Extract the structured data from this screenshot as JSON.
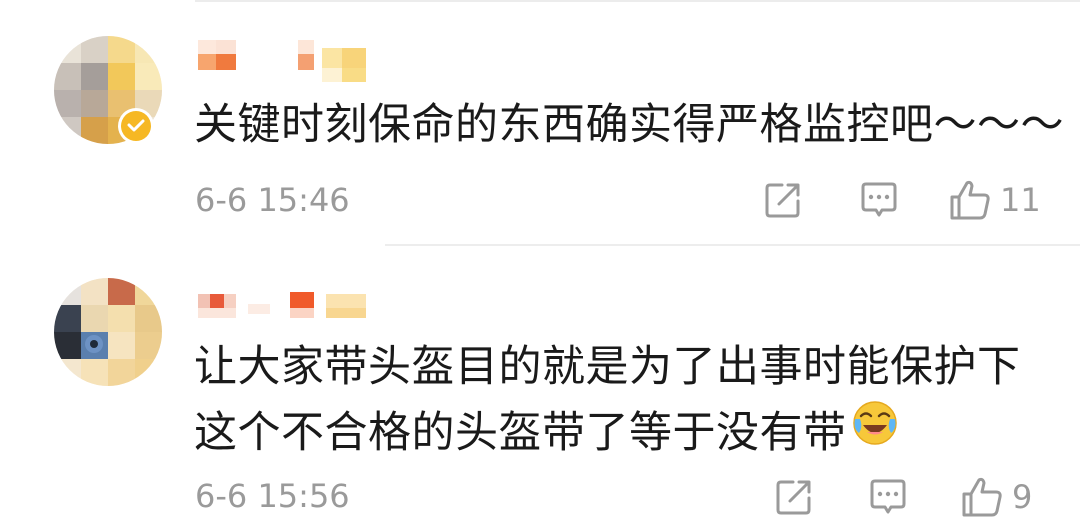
{
  "comments": [
    {
      "text_lines": [
        "关键时刻保命的东西确实得严格监控吧～～～"
      ],
      "timestamp": "6-6 15:46",
      "like_count": "11",
      "verified": true,
      "icons": {
        "repost": "repost-icon",
        "comment": "comment-icon",
        "like": "like-icon",
        "verified": "verified-badge-icon"
      }
    },
    {
      "text_lines": [
        "让大家带头盔目的就是为了出事时能保护下",
        "这个不合格的头盔带了等于没有带"
      ],
      "emoji": "laughing-crying-emoji",
      "timestamp": "6-6 15:56",
      "like_count": "9",
      "verified": false,
      "icons": {
        "repost": "repost-icon",
        "comment": "comment-icon",
        "like": "like-icon"
      }
    }
  ],
  "colors": {
    "text": "#1a1a1a",
    "meta": "#9a9a9a",
    "verified": "#f6b824",
    "divider": "#ededed"
  }
}
